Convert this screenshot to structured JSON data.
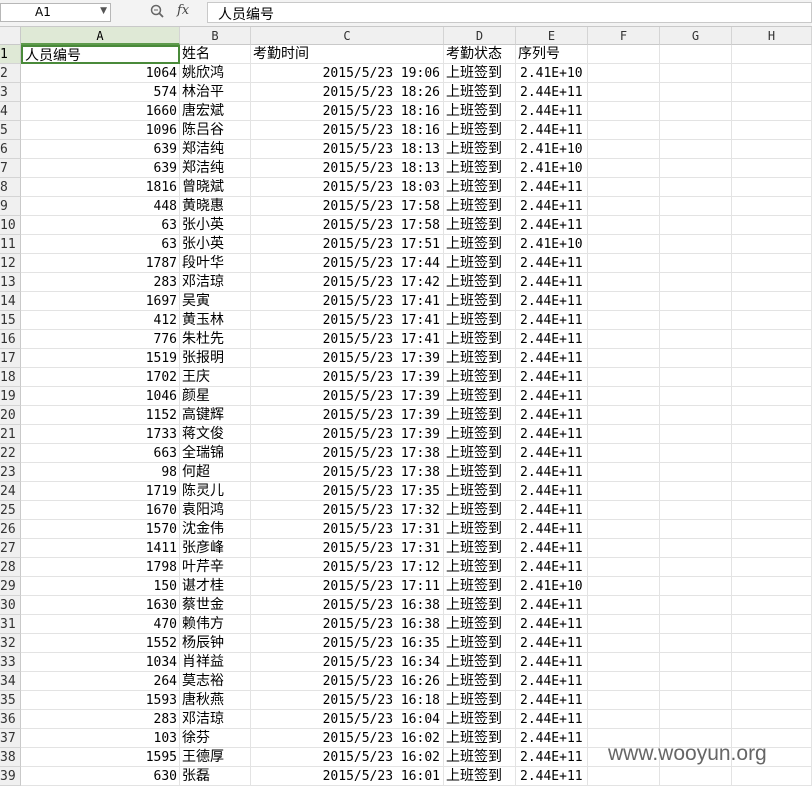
{
  "formula_bar": {
    "name_box": "A1",
    "fx_label": "fx",
    "content": "人员编号"
  },
  "columns": [
    "A",
    "B",
    "C",
    "D",
    "E",
    "F",
    "G",
    "H"
  ],
  "header_row": [
    "人员编号",
    "姓名",
    "考勤时间",
    "考勤状态",
    "序列号"
  ],
  "rows": [
    {
      "row": "1"
    },
    {
      "row": "2",
      "id": "1064",
      "name": "姚欣鸿",
      "time": "2015/5/23 19:06",
      "status": "上班签到",
      "serial": "2.41E+10"
    },
    {
      "row": "3",
      "id": "574",
      "name": "林治平",
      "time": "2015/5/23 18:26",
      "status": "上班签到",
      "serial": "2.44E+11"
    },
    {
      "row": "4",
      "id": "1660",
      "name": "唐宏斌",
      "time": "2015/5/23 18:16",
      "status": "上班签到",
      "serial": "2.44E+11"
    },
    {
      "row": "5",
      "id": "1096",
      "name": "陈吕谷",
      "time": "2015/5/23 18:16",
      "status": "上班签到",
      "serial": "2.44E+11"
    },
    {
      "row": "6",
      "id": "639",
      "name": "郑洁纯",
      "time": "2015/5/23 18:13",
      "status": "上班签到",
      "serial": "2.41E+10"
    },
    {
      "row": "7",
      "id": "639",
      "name": "郑洁纯",
      "time": "2015/5/23 18:13",
      "status": "上班签到",
      "serial": "2.41E+10"
    },
    {
      "row": "8",
      "id": "1816",
      "name": "曾晓斌",
      "time": "2015/5/23 18:03",
      "status": "上班签到",
      "serial": "2.44E+11"
    },
    {
      "row": "9",
      "id": "448",
      "name": "黄晓惠",
      "time": "2015/5/23 17:58",
      "status": "上班签到",
      "serial": "2.44E+11"
    },
    {
      "row": "10",
      "id": "63",
      "name": "张小英",
      "time": "2015/5/23 17:58",
      "status": "上班签到",
      "serial": "2.44E+11"
    },
    {
      "row": "11",
      "id": "63",
      "name": "张小英",
      "time": "2015/5/23 17:51",
      "status": "上班签到",
      "serial": "2.41E+10"
    },
    {
      "row": "12",
      "id": "1787",
      "name": "段叶华",
      "time": "2015/5/23 17:44",
      "status": "上班签到",
      "serial": "2.44E+11"
    },
    {
      "row": "13",
      "id": "283",
      "name": "邓洁琼",
      "time": "2015/5/23 17:42",
      "status": "上班签到",
      "serial": "2.44E+11"
    },
    {
      "row": "14",
      "id": "1697",
      "name": "吴寅",
      "time": "2015/5/23 17:41",
      "status": "上班签到",
      "serial": "2.44E+11"
    },
    {
      "row": "15",
      "id": "412",
      "name": "黄玉林",
      "time": "2015/5/23 17:41",
      "status": "上班签到",
      "serial": "2.44E+11"
    },
    {
      "row": "16",
      "id": "776",
      "name": "朱杜先",
      "time": "2015/5/23 17:41",
      "status": "上班签到",
      "serial": "2.44E+11"
    },
    {
      "row": "17",
      "id": "1519",
      "name": "张报明",
      "time": "2015/5/23 17:39",
      "status": "上班签到",
      "serial": "2.44E+11"
    },
    {
      "row": "18",
      "id": "1702",
      "name": "王庆",
      "time": "2015/5/23 17:39",
      "status": "上班签到",
      "serial": "2.44E+11"
    },
    {
      "row": "19",
      "id": "1046",
      "name": "颜星",
      "time": "2015/5/23 17:39",
      "status": "上班签到",
      "serial": "2.44E+11"
    },
    {
      "row": "20",
      "id": "1152",
      "name": "高键辉",
      "time": "2015/5/23 17:39",
      "status": "上班签到",
      "serial": "2.44E+11"
    },
    {
      "row": "21",
      "id": "1733",
      "name": "蒋文俊",
      "time": "2015/5/23 17:39",
      "status": "上班签到",
      "serial": "2.44E+11"
    },
    {
      "row": "22",
      "id": "663",
      "name": "全瑞锦",
      "time": "2015/5/23 17:38",
      "status": "上班签到",
      "serial": "2.44E+11"
    },
    {
      "row": "23",
      "id": "98",
      "name": "何超",
      "time": "2015/5/23 17:38",
      "status": "上班签到",
      "serial": "2.44E+11"
    },
    {
      "row": "24",
      "id": "1719",
      "name": "陈灵儿",
      "time": "2015/5/23 17:35",
      "status": "上班签到",
      "serial": "2.44E+11"
    },
    {
      "row": "25",
      "id": "1670",
      "name": "袁阳鸿",
      "time": "2015/5/23 17:32",
      "status": "上班签到",
      "serial": "2.44E+11"
    },
    {
      "row": "26",
      "id": "1570",
      "name": "沈金伟",
      "time": "2015/5/23 17:31",
      "status": "上班签到",
      "serial": "2.44E+11"
    },
    {
      "row": "27",
      "id": "1411",
      "name": "张彦峰",
      "time": "2015/5/23 17:31",
      "status": "上班签到",
      "serial": "2.44E+11"
    },
    {
      "row": "28",
      "id": "1798",
      "name": "叶芹辛",
      "time": "2015/5/23 17:12",
      "status": "上班签到",
      "serial": "2.44E+11"
    },
    {
      "row": "29",
      "id": "150",
      "name": "谌才桂",
      "time": "2015/5/23 17:11",
      "status": "上班签到",
      "serial": "2.41E+10"
    },
    {
      "row": "30",
      "id": "1630",
      "name": "蔡世金",
      "time": "2015/5/23 16:38",
      "status": "上班签到",
      "serial": "2.44E+11"
    },
    {
      "row": "31",
      "id": "470",
      "name": "赖伟方",
      "time": "2015/5/23 16:38",
      "status": "上班签到",
      "serial": "2.44E+11"
    },
    {
      "row": "32",
      "id": "1552",
      "name": "杨辰钟",
      "time": "2015/5/23 16:35",
      "status": "上班签到",
      "serial": "2.44E+11"
    },
    {
      "row": "33",
      "id": "1034",
      "name": "肖祥益",
      "time": "2015/5/23 16:34",
      "status": "上班签到",
      "serial": "2.44E+11"
    },
    {
      "row": "34",
      "id": "264",
      "name": "莫志裕",
      "time": "2015/5/23 16:26",
      "status": "上班签到",
      "serial": "2.44E+11"
    },
    {
      "row": "35",
      "id": "1593",
      "name": "唐秋燕",
      "time": "2015/5/23 16:18",
      "status": "上班签到",
      "serial": "2.44E+11"
    },
    {
      "row": "36",
      "id": "283",
      "name": "邓洁琼",
      "time": "2015/5/23 16:04",
      "status": "上班签到",
      "serial": "2.44E+11"
    },
    {
      "row": "37",
      "id": "103",
      "name": "徐芬",
      "time": "2015/5/23 16:02",
      "status": "上班签到",
      "serial": "2.44E+11"
    },
    {
      "row": "38",
      "id": "1595",
      "name": "王德厚",
      "time": "2015/5/23 16:02",
      "status": "上班签到",
      "serial": "2.44E+11"
    },
    {
      "row": "39",
      "id": "630",
      "name": "张磊",
      "time": "2015/5/23 16:01",
      "status": "上班签到",
      "serial": "2.44E+11"
    }
  ],
  "watermark": "www.wooyun.org",
  "colors": {
    "accent": "#4a8a3a",
    "selected_header": "#dfe9d6"
  }
}
